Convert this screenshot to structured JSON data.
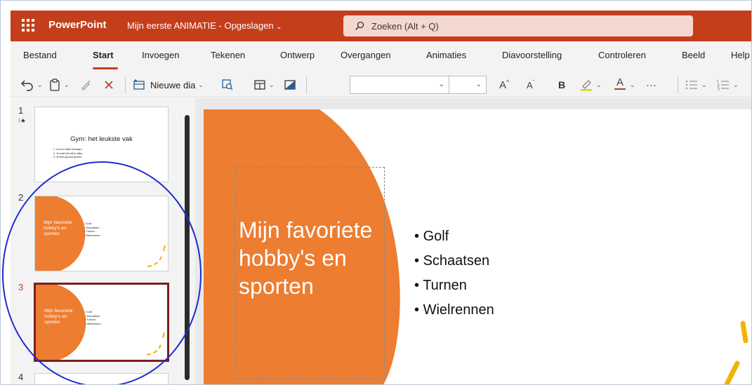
{
  "app": {
    "name": "PowerPoint",
    "document_title": "Mijn eerste ANIMATIE - Opgeslagen",
    "search_placeholder": "Zoeken (Alt + Q)",
    "accent_color": "#c43e1c"
  },
  "ribbon": {
    "tabs": [
      {
        "label": "Bestand"
      },
      {
        "label": "Start",
        "active": true
      },
      {
        "label": "Invoegen"
      },
      {
        "label": "Tekenen"
      },
      {
        "label": "Ontwerp"
      },
      {
        "label": "Overgangen"
      },
      {
        "label": "Animaties"
      },
      {
        "label": "Diavoorstelling"
      },
      {
        "label": "Controleren"
      },
      {
        "label": "Beeld"
      },
      {
        "label": "Help"
      }
    ]
  },
  "toolbar": {
    "new_slide_label": "Nieuwe dia",
    "icons": [
      "undo-icon",
      "paste-icon",
      "format-painter-icon",
      "delete-icon",
      "new-slide-icon",
      "reuse-slides-icon",
      "layout-icon",
      "shape-fill-icon",
      "font-size-increase-icon",
      "font-size-decrease-icon",
      "bold-icon",
      "highlighter-icon",
      "font-color-icon",
      "more-icon",
      "bullets-icon",
      "numbering-icon"
    ],
    "increase_font": "A",
    "decrease_font": "A",
    "bold": "B",
    "font_color": "A",
    "more": "···"
  },
  "slides": [
    {
      "number": "1",
      "has_animation": true,
      "animation_icon": "animation-star-icon",
      "title": "Gym: het leukste vak",
      "items": [
        "1. Je kunt lekker bewegen",
        "2. Je hoeft niet stil te zitten",
        "3. Je leert gezond sporten"
      ]
    },
    {
      "number": "2",
      "title": "Mijn favoriete hobby's en sporten",
      "bullets": [
        "Golf",
        "Schaatsen",
        "Turnen",
        "Wielrennen"
      ]
    },
    {
      "number": "3",
      "selected": true,
      "title": "Mijn favoriete hobby's en sporten",
      "bullets": [
        "Golf",
        "Schaatsen",
        "Turnen",
        "Wielrennen"
      ]
    },
    {
      "number": "4"
    }
  ],
  "current_slide": {
    "title": "Mijn favoriete hobby's en sporten",
    "bullets": [
      "Golf",
      "Schaatsen",
      "Turnen",
      "Wielrennen"
    ],
    "shape_color": "#ed7d31",
    "decoration_color": "#f0b400"
  },
  "annotation": {
    "color": "#1f2bd1"
  }
}
